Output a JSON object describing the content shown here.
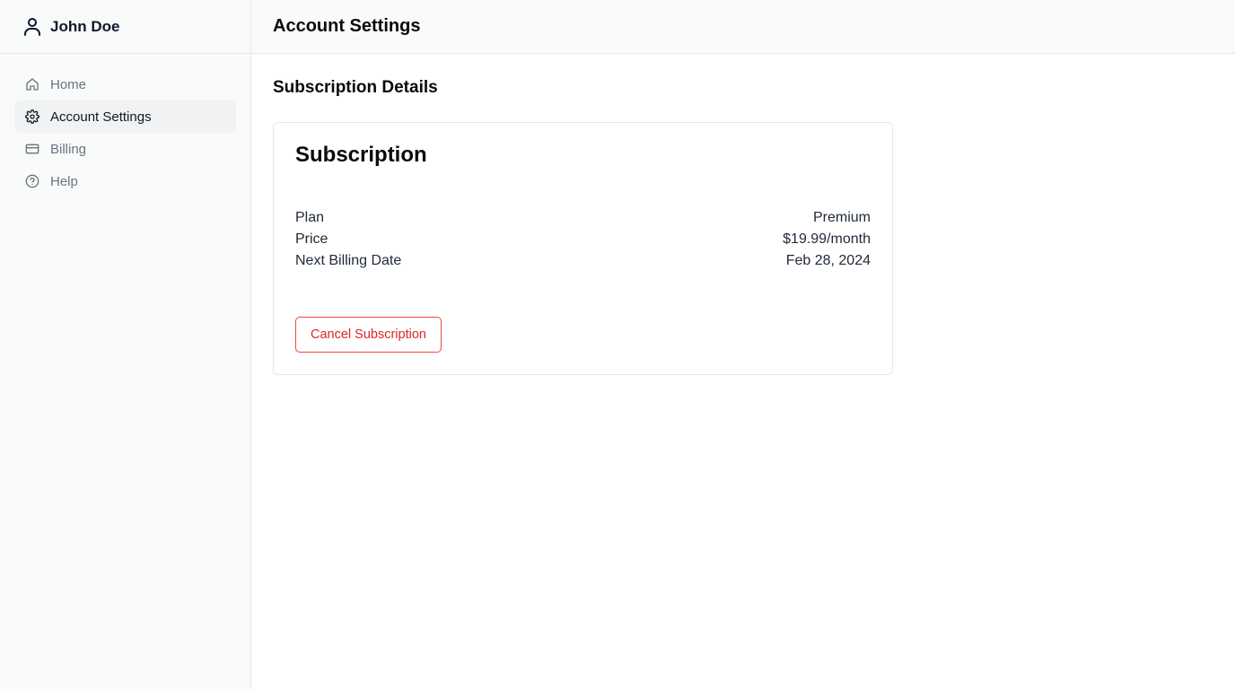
{
  "user": {
    "name": "John Doe",
    "icon": "user-icon"
  },
  "sidebar": {
    "items": [
      {
        "label": "Home",
        "icon": "home-icon",
        "active": false
      },
      {
        "label": "Account Settings",
        "icon": "gear-icon",
        "active": true
      },
      {
        "label": "Billing",
        "icon": "credit-card-icon",
        "active": false
      },
      {
        "label": "Help",
        "icon": "help-circle-icon",
        "active": false
      }
    ]
  },
  "header": {
    "title": "Account Settings"
  },
  "main": {
    "section_title": "Subscription Details",
    "card": {
      "title": "Subscription",
      "details": [
        {
          "label": "Plan",
          "value": "Premium"
        },
        {
          "label": "Price",
          "value": "$19.99/month"
        },
        {
          "label": "Next Billing Date",
          "value": "Feb 28, 2024"
        }
      ],
      "cancel_label": "Cancel Subscription"
    }
  },
  "colors": {
    "danger": "#ef4444",
    "sidebar_bg": "#f9fafa",
    "active_bg": "#f0f2f4",
    "muted_text": "#6b7280"
  }
}
